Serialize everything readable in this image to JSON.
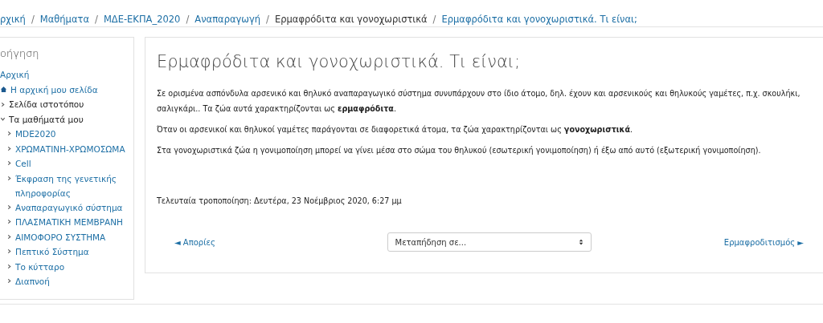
{
  "breadcrumb_separator": "/",
  "breadcrumb": [
    {
      "label": "ρχική",
      "link": true
    },
    {
      "label": "Μαθήματα",
      "link": true
    },
    {
      "label": "ΜΔΕ-ΕΚΠΑ_2020",
      "link": true
    },
    {
      "label": "Αναπαραγωγή",
      "link": true
    },
    {
      "label": "Ερμαφρόδιτα και γονοχωριστικά",
      "link": false
    },
    {
      "label": "Ερμαφρόδιτα και γονοχωριστικά. Τι είναι;",
      "link": true
    }
  ],
  "sidebar": {
    "heading": "οήγηση",
    "items": [
      {
        "kind": "link",
        "label": "Αρχική"
      },
      {
        "kind": "dashboard",
        "label": "Η αρχική μου σελίδα"
      },
      {
        "kind": "node",
        "label": "Σελίδα ιστοτόπου",
        "expanded": false
      },
      {
        "kind": "node",
        "label": "Τα μαθήματά μου",
        "expanded": true,
        "children": [
          {
            "label": "MDE2020",
            "expanded": false
          },
          {
            "label": "ΧΡΩΜΑΤΙΝΗ-ΧΡΩΜΟΣΩΜΑ",
            "expanded": false
          },
          {
            "label": "Cell",
            "expanded": false
          },
          {
            "label": "Έκφραση της γενετικής πληροφορίας",
            "expanded": false
          },
          {
            "label": "Αναπαραγωγικό σύστημα",
            "expanded": false
          },
          {
            "label": "ΠΛΑΣΜΑΤΙΚΗ ΜΕΜΒΡΑΝΗ",
            "expanded": false
          },
          {
            "label": "ΑΙΜΟΦΟΡΟ ΣΥΣΤΗΜΑ",
            "expanded": false
          },
          {
            "label": "Πεπτικό Σύστημα",
            "expanded": false
          },
          {
            "label": "Το κύτταρο",
            "expanded": false
          },
          {
            "label": "Διαπνοή",
            "expanded": false
          }
        ]
      }
    ]
  },
  "page": {
    "title": "Ερμαφρόδιτα και γονοχωριστικά. Τι είναι;",
    "paragraphs": [
      "Σε ορισμένα ασπόνδυλα αρσενικό και θηλυκό αναπαραγωγικό σύστημα συνυπάρχουν στο ίδιο άτομο, δηλ. έχουν και αρσενικούς και θηλυκούς γαμέτες, π.χ. σκουλήκι, σαλιγκάρι.. Τα ζώα αυτά χαρακτηρίζονται ως **ερμαφρόδιτα**.",
      "Όταν οι αρσενικοί και θηλυκοί γαμέτες παράγονται σε διαφορετικά άτομα, τα ζώα χαρακτηρίζονται ως **γονοχωριστικά**.",
      "Στα γονοχωριστικά ζώα η γονιμοποίηση μπορεί να γίνει μέσα στο σώμα του θηλυκού (εσωτερική γονιμοποίηση) ή έξω από αυτό (εξωτερική γονιμοποίηση)."
    ],
    "modified": "Τελευταία τροποποίηση: Δευτέρα, 23 Νοέμβριος 2020, 6:27 μμ",
    "prev_link": "◄ Απορίες",
    "jump_select": "Μεταπήδηση σε...",
    "next_link": "Ερμαφροδιτισμός ►"
  }
}
